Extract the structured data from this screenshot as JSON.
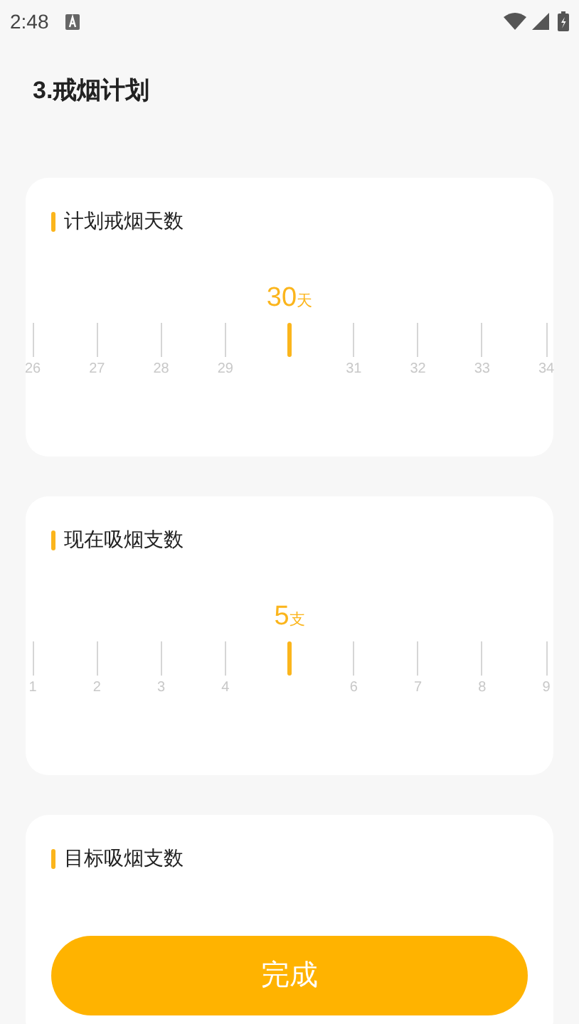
{
  "status_bar": {
    "time": "2:48"
  },
  "title": "3.戒烟计划",
  "cards": [
    {
      "title": "计划戒烟天数",
      "value": "30",
      "unit": "天",
      "ticks": [
        {
          "label": "26",
          "selected": false
        },
        {
          "label": "27",
          "selected": false
        },
        {
          "label": "28",
          "selected": false
        },
        {
          "label": "29",
          "selected": false
        },
        {
          "selected": true
        },
        {
          "label": "31",
          "selected": false
        },
        {
          "label": "32",
          "selected": false
        },
        {
          "label": "33",
          "selected": false
        },
        {
          "label": "34",
          "selected": false
        }
      ]
    },
    {
      "title": "现在吸烟支数",
      "value": "5",
      "unit": "支",
      "ticks": [
        {
          "label": "1",
          "selected": false
        },
        {
          "label": "2",
          "selected": false
        },
        {
          "label": "3",
          "selected": false
        },
        {
          "label": "4",
          "selected": false
        },
        {
          "selected": true
        },
        {
          "label": "6",
          "selected": false
        },
        {
          "label": "7",
          "selected": false
        },
        {
          "label": "8",
          "selected": false
        },
        {
          "label": "9",
          "selected": false
        }
      ]
    },
    {
      "title": "目标吸烟支数"
    }
  ],
  "button": "完成"
}
